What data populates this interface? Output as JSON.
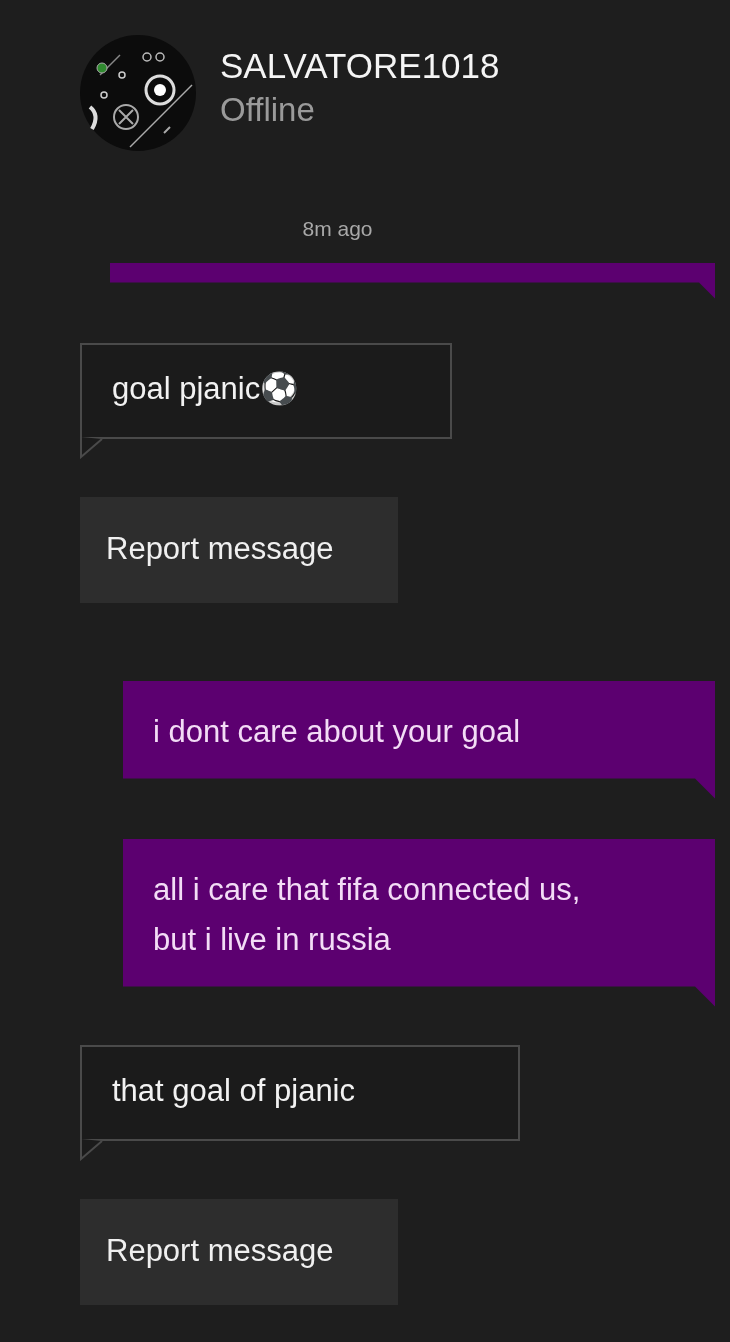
{
  "contact": {
    "name": "SALVATORE1018",
    "status": "Offline"
  },
  "timestamp": "8m ago",
  "messages": [
    {
      "kind": "outgoing_partial"
    },
    {
      "kind": "incoming",
      "text": "goal pjanic⚽"
    },
    {
      "kind": "report",
      "text": "Report message"
    },
    {
      "kind": "outgoing",
      "text": "i dont care about your goal"
    },
    {
      "kind": "outgoing",
      "text": "all i care that fifa connected us, but i live in russia"
    },
    {
      "kind": "incoming",
      "text": "that goal of pjanic"
    },
    {
      "kind": "report",
      "text": "Report message"
    }
  ]
}
